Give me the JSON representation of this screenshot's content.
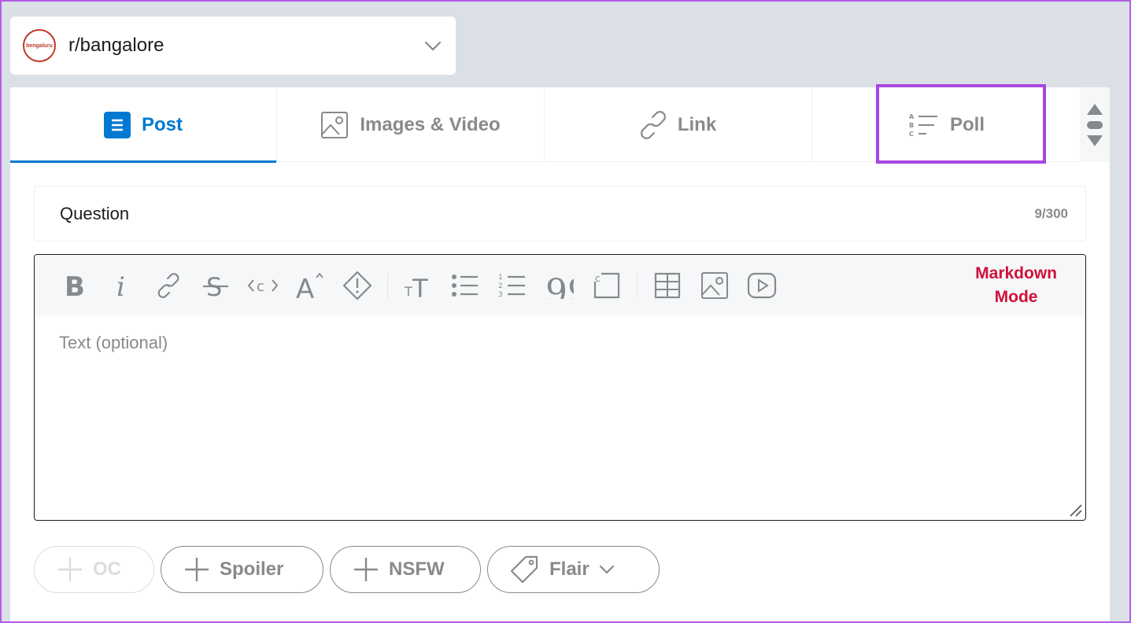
{
  "community": {
    "name": "r/bangalore",
    "avatar_text": "bengaluru"
  },
  "tabs": [
    {
      "label": "Post",
      "icon": "post-icon",
      "active": true
    },
    {
      "label": "Images & Video",
      "icon": "image-icon",
      "active": false
    },
    {
      "label": "Link",
      "icon": "link-icon",
      "active": false
    },
    {
      "label": "Poll",
      "icon": "poll-icon",
      "active": false
    }
  ],
  "question": {
    "value": "Question",
    "count": "9/300"
  },
  "editor": {
    "toolbar": [
      "bold-icon",
      "italic-icon",
      "link-icon",
      "strikethrough-icon",
      "inline-code-icon",
      "superscript-icon",
      "spoiler-icon",
      "heading-icon",
      "bulleted-list-icon",
      "numbered-list-icon",
      "quote-icon",
      "code-block-icon",
      "table-icon",
      "image-icon",
      "video-icon"
    ],
    "markdown_line1": "Markdown",
    "markdown_line2": "Mode",
    "placeholder": "Text (optional)"
  },
  "tags": {
    "oc": "OC",
    "spoiler": "Spoiler",
    "nsfw": "NSFW",
    "flair": "Flair"
  },
  "colors": {
    "accent": "#0079d3",
    "highlight": "#a845e0",
    "markdown": "#d0103a",
    "background": "#dae0e6"
  }
}
